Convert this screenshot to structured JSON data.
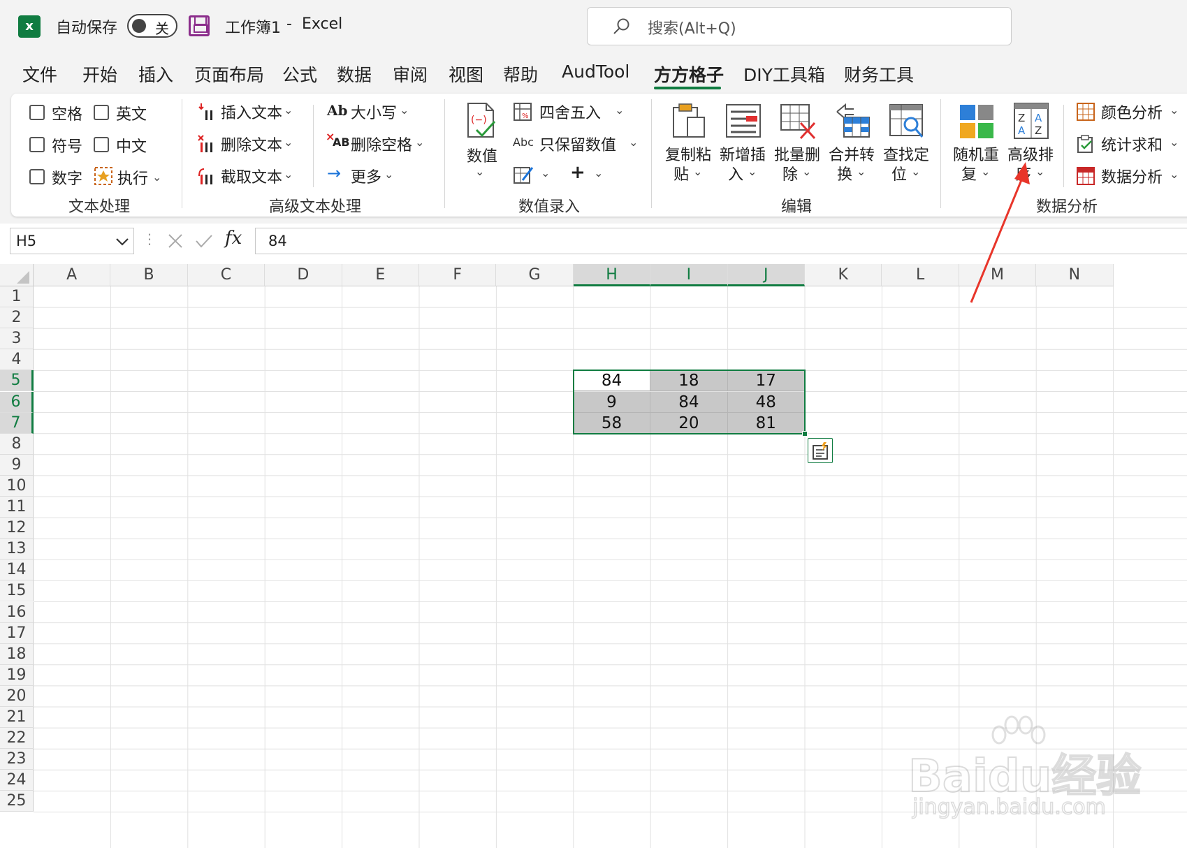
{
  "titlebar": {
    "autosave_label": "自动保存",
    "autosave_state": "关",
    "workbook": "工作簿1",
    "dash": "-",
    "app": "Excel",
    "search_placeholder": "搜索(Alt+Q)"
  },
  "menu": {
    "items": [
      "文件",
      "开始",
      "插入",
      "页面布局",
      "公式",
      "数据",
      "审阅",
      "视图",
      "帮助",
      "AudTool",
      "方方格子",
      "DIY工具箱",
      "财务工具"
    ],
    "active": "方方格子"
  },
  "ribbon": {
    "text_group": {
      "label": "文本处理",
      "options": [
        "空格",
        "英文",
        "符号",
        "中文",
        "数字"
      ],
      "execute": "执行"
    },
    "advanced_text_group": {
      "label": "高级文本处理",
      "insert_text": "插入文本",
      "delete_text": "删除文本",
      "extract_text": "截取文本",
      "case": "大小写",
      "delete_space": "删除空格",
      "more": "更多",
      "case_icon": "Ab",
      "delete_space_icon": "AB"
    },
    "numeric_group": {
      "label": "数值录入",
      "value": "数值",
      "round": "四舍五入",
      "keep_numbers": "只保留数值",
      "keep_icon": "Abc",
      "plus": "+"
    },
    "edit_group": {
      "label": "编辑",
      "copy_paste": [
        "复制粘",
        "贴"
      ],
      "add_insert": [
        "新增插",
        "入"
      ],
      "batch_delete": [
        "批量删",
        "除"
      ],
      "merge_convert": [
        "合并转",
        "换"
      ],
      "find_locate": [
        "查找定",
        "位"
      ]
    },
    "analysis_group": {
      "label": "数据分析",
      "random_repeat": [
        "随机重",
        "复"
      ],
      "advanced_sort": [
        "高级排",
        "序"
      ],
      "color_analysis": "颜色分析",
      "stat_sum": "统计求和",
      "data_analysis": "数据分析"
    }
  },
  "formula_bar": {
    "cell_ref": "H5",
    "fx": "fx",
    "value": "84"
  },
  "sheet": {
    "columns": [
      "A",
      "B",
      "C",
      "D",
      "E",
      "F",
      "G",
      "H",
      "I",
      "J",
      "K",
      "L",
      "M",
      "N"
    ],
    "rows": [
      "1",
      "2",
      "3",
      "4",
      "5",
      "6",
      "7",
      "8",
      "9",
      "10",
      "11",
      "12",
      "13",
      "14",
      "15",
      "16",
      "17",
      "18",
      "19",
      "20",
      "21",
      "22",
      "23",
      "24",
      "25"
    ],
    "selected_columns": [
      "H",
      "I",
      "J"
    ],
    "selected_rows": [
      "5",
      "6",
      "7"
    ],
    "values": {
      "H5": "84",
      "I5": "18",
      "J5": "17",
      "H6": "9",
      "I6": "84",
      "J6": "48",
      "H7": "58",
      "I7": "20",
      "J7": "81"
    }
  },
  "watermark": {
    "brand": "Baidu经验",
    "url": "jingyan.baidu.com"
  },
  "colors": {
    "excel_green": "#107c41",
    "selection_fill": "#c8c8c8",
    "annotation_red": "#e8352a"
  }
}
